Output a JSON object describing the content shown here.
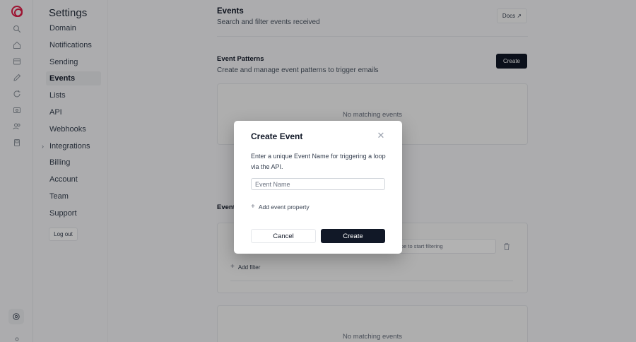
{
  "sidebar": {
    "icons": [
      "home-icon",
      "search-icon",
      "home-icon",
      "lock-icon",
      "edit-icon",
      "refresh-icon",
      "user-icon",
      "users-icon",
      "document-icon"
    ],
    "bottom_icon": "settings-icon"
  },
  "settings": {
    "title": "Settings",
    "items": [
      {
        "label": "Domain"
      },
      {
        "label": "Notifications"
      },
      {
        "label": "Sending"
      },
      {
        "label": "Events"
      },
      {
        "label": "Lists"
      },
      {
        "label": "API"
      },
      {
        "label": "Webhooks"
      },
      {
        "label": "Integrations"
      },
      {
        "label": "Billing"
      },
      {
        "label": "Account"
      },
      {
        "label": "Team"
      },
      {
        "label": "Support"
      }
    ],
    "active": "Events",
    "logout_label": "Log out"
  },
  "main": {
    "title": "Events",
    "subtitle": "Search and filter events received",
    "docs_label": "Docs ↗",
    "patterns": {
      "title": "Event Patterns",
      "subtitle": "Create and manage event patterns to trigger emails",
      "create_label": "Create",
      "empty_text": "No matching events"
    },
    "events_section": {
      "title_prefix": "Event",
      "filter_placeholder": "pe to start filtering",
      "add_filter_label": "Add filter",
      "empty_text": "No matching events"
    }
  },
  "modal": {
    "title": "Create Event",
    "description": "Enter a unique Event Name for triggering a loop via the API.",
    "input_placeholder": "Event Name",
    "add_property_label": "Add event property",
    "cancel_label": "Cancel",
    "create_label": "Create"
  }
}
